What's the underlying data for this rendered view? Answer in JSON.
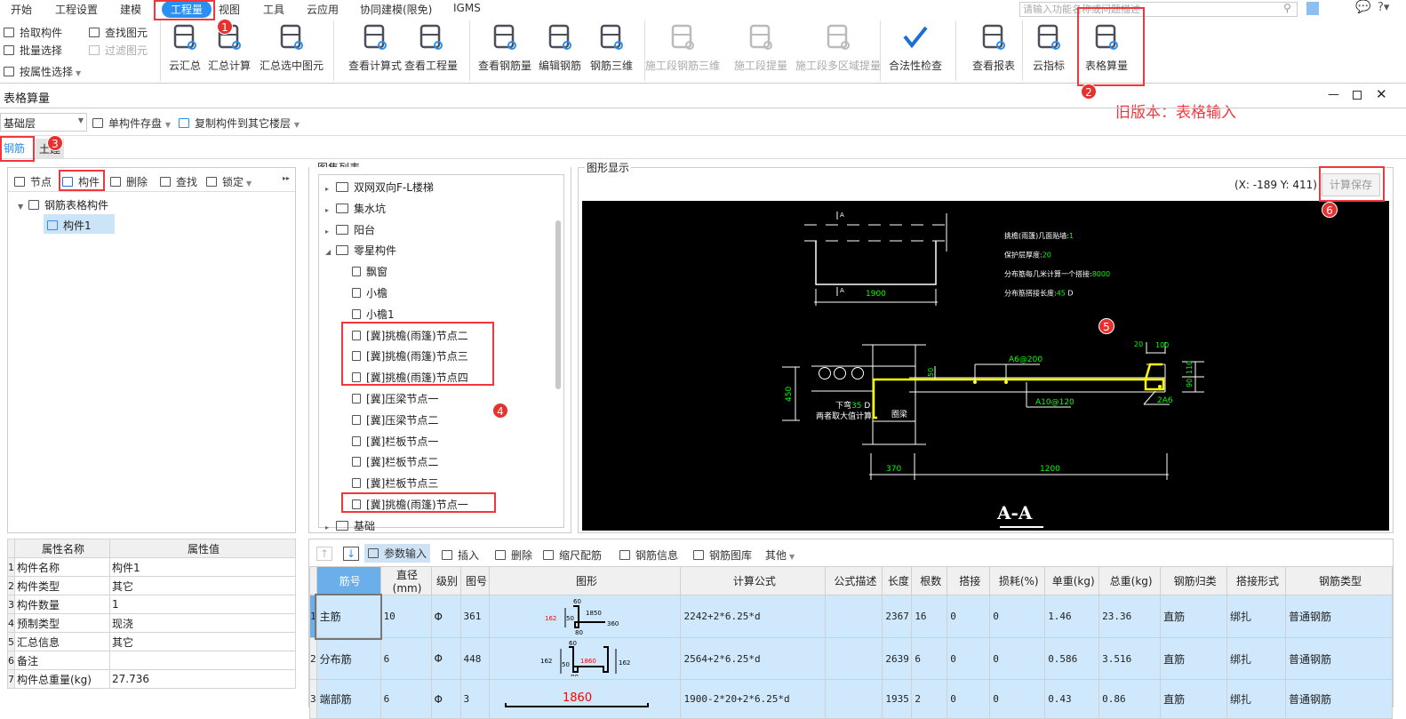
{
  "menu": {
    "items": [
      "开始",
      "工程设置",
      "建模",
      "工程量",
      "视图",
      "工具",
      "云应用",
      "协同建模(限免)",
      "IGMS"
    ],
    "active": "工程量",
    "search_placeholder": "请输入功能名称或问题描述"
  },
  "ribbon": {
    "small": [
      "拾取构件",
      "批量选择",
      "按属性选择",
      "查找图元",
      "过滤图元"
    ],
    "big": [
      {
        "label": "云汇总",
        "icon": "cloud-sigma-icon",
        "enabled": true
      },
      {
        "label": "汇总计算",
        "icon": "sigma-doc-icon",
        "enabled": true
      },
      {
        "label": "汇总选中图元",
        "icon": "sigma-cursor-icon",
        "enabled": true
      },
      {
        "label": "查看计算式",
        "icon": "formula-view-icon",
        "enabled": true
      },
      {
        "label": "查看工程量",
        "icon": "quantity-view-icon",
        "enabled": true
      },
      {
        "label": "查看钢筋量",
        "icon": "rebar-view-icon",
        "enabled": true
      },
      {
        "label": "编辑钢筋",
        "icon": "edit-rebar-icon",
        "enabled": true
      },
      {
        "label": "钢筋三维",
        "icon": "rebar-3d-icon",
        "enabled": true
      },
      {
        "label": "施工段钢筋三维",
        "icon": "stage-rebar-3d-icon",
        "enabled": false
      },
      {
        "label": "施工段提量",
        "icon": "stage-quantity-icon",
        "enabled": false
      },
      {
        "label": "施工段多区域提量",
        "icon": "stage-multi-area-icon",
        "enabled": false
      },
      {
        "label": "合法性检查",
        "icon": "check-icon",
        "enabled": true
      },
      {
        "label": "查看报表",
        "icon": "report-icon",
        "enabled": true
      },
      {
        "label": "云指标",
        "icon": "cloud-chart-icon",
        "enabled": true
      },
      {
        "label": "表格算量",
        "icon": "table-edit-icon",
        "enabled": true
      }
    ]
  },
  "window": {
    "title": "表格算量",
    "annotation": "旧版本：表格输入"
  },
  "toolbar": {
    "floor": "基础层",
    "save_single": "单构件存盘",
    "copy_to_floor": "复制构件到其它楼层"
  },
  "tabs": [
    "钢筋",
    "土建"
  ],
  "left": {
    "tools": [
      "节点",
      "构件",
      "删除",
      "查找",
      "锁定"
    ],
    "tree_root": "钢筋表格构件",
    "tree_child": "构件1"
  },
  "properties": {
    "headers": [
      "属性名称",
      "属性值"
    ],
    "rows": [
      [
        "构件名称",
        "构件1"
      ],
      [
        "构件类型",
        "其它"
      ],
      [
        "构件数量",
        "1"
      ],
      [
        "预制类型",
        "现浇"
      ],
      [
        "汇总信息",
        "其它"
      ],
      [
        "备注",
        ""
      ],
      [
        "构件总重量(kg)",
        "27.736"
      ]
    ]
  },
  "atlas": {
    "title": "图集列表",
    "items": [
      {
        "label": "双网双向F-L楼梯",
        "type": "folder",
        "level": 0
      },
      {
        "label": "集水坑",
        "type": "folder",
        "level": 0
      },
      {
        "label": "阳台",
        "type": "folder",
        "level": 0
      },
      {
        "label": "零星构件",
        "type": "folder-open",
        "level": 0
      },
      {
        "label": "飘窗",
        "type": "doc",
        "level": 1
      },
      {
        "label": "小檐",
        "type": "doc",
        "level": 1
      },
      {
        "label": "小檐1",
        "type": "doc",
        "level": 1
      },
      {
        "label": "[冀]挑檐(雨篷)节点二",
        "type": "doc",
        "level": 1
      },
      {
        "label": "[冀]挑檐(雨篷)节点三",
        "type": "doc",
        "level": 1
      },
      {
        "label": "[冀]挑檐(雨篷)节点四",
        "type": "doc",
        "level": 1
      },
      {
        "label": "[冀]压梁节点一",
        "type": "doc",
        "level": 1
      },
      {
        "label": "[冀]压梁节点二",
        "type": "doc",
        "level": 1
      },
      {
        "label": "[冀]栏板节点一",
        "type": "doc",
        "level": 1
      },
      {
        "label": "[冀]栏板节点二",
        "type": "doc",
        "level": 1
      },
      {
        "label": "[冀]栏板节点三",
        "type": "doc",
        "level": 1
      },
      {
        "label": "[冀]挑檐(雨篷)节点一",
        "type": "doc",
        "level": 1
      },
      {
        "label": "基础",
        "type": "folder",
        "level": 0
      }
    ]
  },
  "graphic": {
    "title": "图形显示",
    "coords": "(X: -189 Y: 411)",
    "save_button": "计算保存",
    "params": [
      [
        "挑檐(雨篷)几面贴墙:",
        "1",
        ""
      ],
      [
        "保护层厚度:",
        "20",
        ""
      ],
      [
        "分布筋每几米计算一个搭接:",
        "8000",
        ""
      ],
      [
        "分布筋搭接长度:",
        "45",
        " D"
      ]
    ],
    "labels": {
      "plan_A": "A",
      "plan_dim": "1900",
      "rebar1": "A6@200",
      "rebar2": "A10@120",
      "bend": "下弯",
      "bend_val": "35",
      "bend_unit": " D",
      "bend_note": "两者取大值计算",
      "beam": "圈梁",
      "d450": "450",
      "d50": "50",
      "d370": "370",
      "d1200": "1200",
      "d20": "20",
      "d100": "100",
      "d110": "110",
      "d90": "90",
      "d2a6": "2A6",
      "section": "A-A"
    }
  },
  "grid": {
    "tools": [
      "参数输入",
      "插入",
      "删除",
      "缩尺配筋",
      "钢筋信息",
      "钢筋图库",
      "其他"
    ],
    "headers": [
      "筋号",
      "直径(mm)",
      "级别",
      "图号",
      "图形",
      "计算公式",
      "公式描述",
      "长度",
      "根数",
      "搭接",
      "损耗(%)",
      "单重(kg)",
      "总重(kg)",
      "钢筋归类",
      "搭接形式",
      "钢筋类型"
    ],
    "rows": [
      {
        "no": "1",
        "cells": [
          "主筋",
          "10",
          "Φ",
          "361",
          "",
          "2242+2*6.25*d",
          "",
          "2367",
          "16",
          "0",
          "0",
          "1.46",
          "23.36",
          "直筋",
          "绑扎",
          "普通钢筋"
        ],
        "shape": [
          "162",
          "50",
          "60",
          "1850",
          "360",
          "80"
        ]
      },
      {
        "no": "2",
        "cells": [
          "分布筋",
          "6",
          "Φ",
          "448",
          "",
          "2564+2*6.25*d",
          "",
          "2639",
          "6",
          "0",
          "0",
          "0.586",
          "3.516",
          "直筋",
          "绑扎",
          "普通钢筋"
        ],
        "shape": [
          "162",
          "50",
          "60",
          "1860",
          "162",
          "80"
        ]
      },
      {
        "no": "3",
        "cells": [
          "端部筋",
          "6",
          "Φ",
          "3",
          "",
          "1900-2*20+2*6.25*d",
          "",
          "1935",
          "2",
          "0",
          "0",
          "0.43",
          "0.86",
          "直筋",
          "绑扎",
          "普通钢筋"
        ],
        "shape": [
          "1860"
        ]
      }
    ]
  },
  "badges": [
    "1",
    "2",
    "3",
    "4",
    "5",
    "6"
  ],
  "colors": {
    "accent": "#2b8ff0",
    "annotation": "#f2363b",
    "canvas": "#000000",
    "cad_green": "#00ff00",
    "cad_yellow": "#ffff00",
    "row_bg": "#cfe8fb"
  }
}
